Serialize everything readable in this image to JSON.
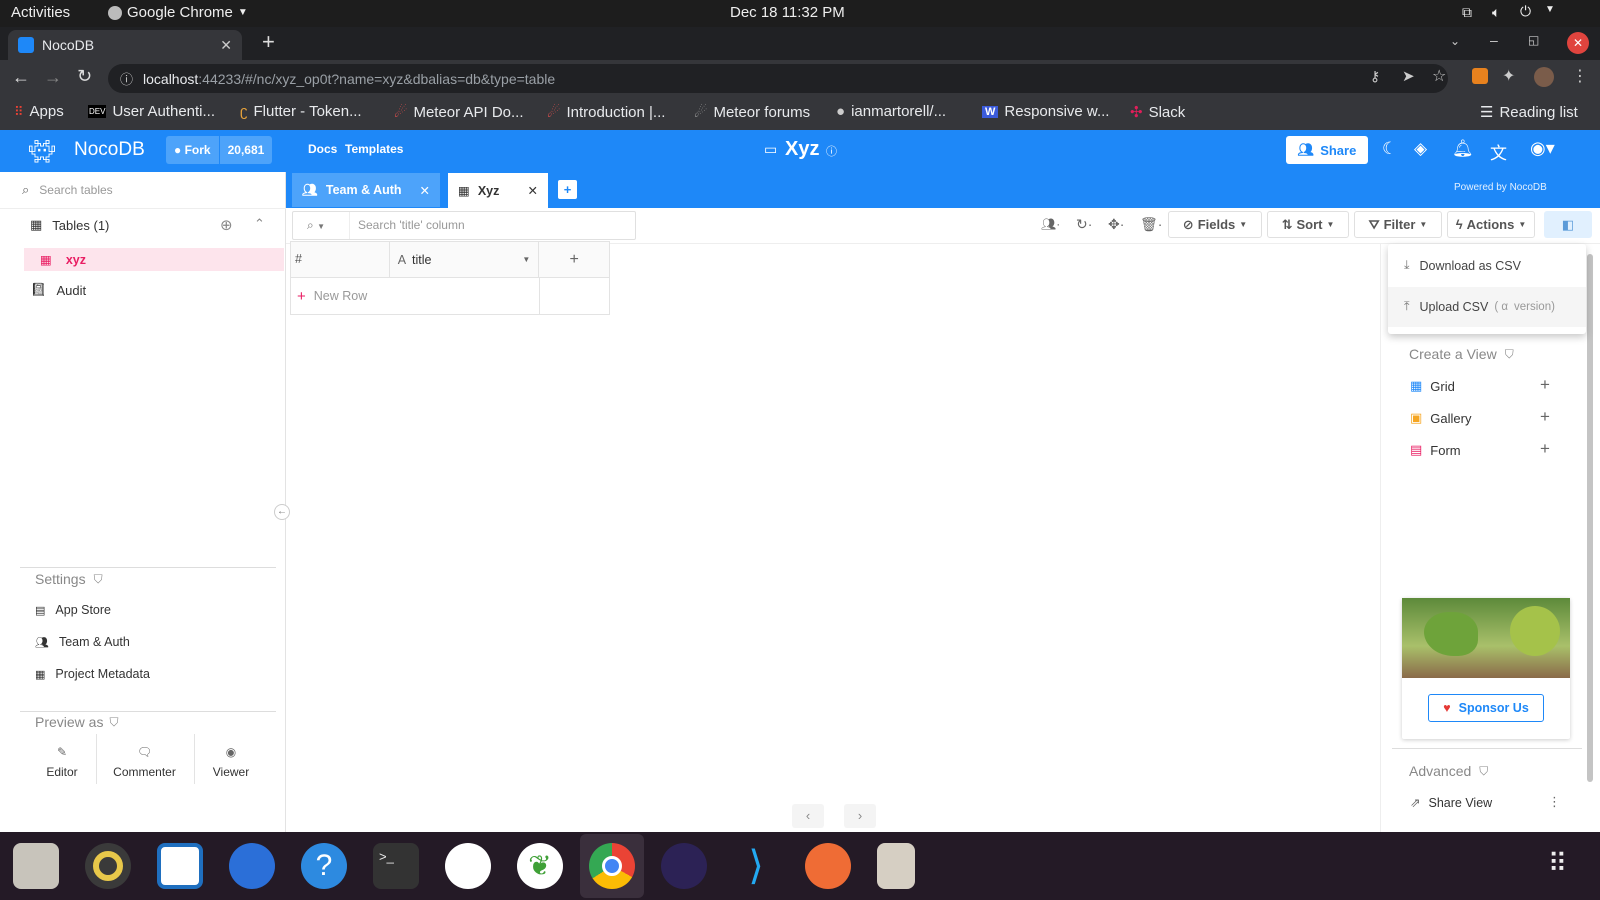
{
  "os": {
    "activities": "Activities",
    "app_name": "Google Chrome",
    "clock": "Dec 18  11:32 PM"
  },
  "browser": {
    "tab_title": "NocoDB",
    "url_host": "localhost",
    "url_rest": ":44233/#/nc/xyz_op0t?name=xyz&dbalias=db&type=table",
    "bookmarks": [
      "Apps",
      "User Authenti...",
      "Flutter - Token...",
      "Meteor API Do...",
      "Introduction |...",
      "Meteor forums",
      "ianmartorell/...",
      "Responsive w...",
      "Slack"
    ],
    "reading_list": "Reading list"
  },
  "header": {
    "brand": "NocoDB",
    "fork": "Fork",
    "stars": "20,681",
    "docs": "Docs",
    "templates": "Templates",
    "project": "Xyz",
    "share": "Share",
    "powered": "Powered by NocoDB"
  },
  "tabs": [
    {
      "label": "Team & Auth"
    },
    {
      "label": "Xyz"
    }
  ],
  "sidebar": {
    "search_placeholder": "Search tables",
    "tables_label": "Tables (1)",
    "table_item": "xyz",
    "audit": "Audit",
    "settings": "Settings",
    "settings_items": [
      "App Store",
      "Team & Auth",
      "Project Metadata"
    ],
    "preview_as": "Preview as",
    "roles": [
      "Editor",
      "Commenter",
      "Viewer"
    ]
  },
  "toolbar": {
    "search_placeholder": "Search 'title' column",
    "fields": "Fields",
    "sort": "Sort",
    "filter": "Filter",
    "actions": "Actions"
  },
  "grid": {
    "col_hash": "#",
    "col_title": "title",
    "new_row": "New Row"
  },
  "actions_menu": {
    "download": "Download as CSV",
    "upload": "Upload CSV",
    "upload_suffix_a": "( α",
    "upload_suffix_b": "version)"
  },
  "views": {
    "create_label": "Create a View",
    "items": [
      "Grid",
      "Gallery",
      "Form"
    ],
    "sponsor": "Sponsor Us",
    "advanced": "Advanced",
    "share_view": "Share View"
  },
  "colors": {
    "primary": "#1e88f8",
    "pink": "#e91e63",
    "highlight": "#fde4ec"
  }
}
